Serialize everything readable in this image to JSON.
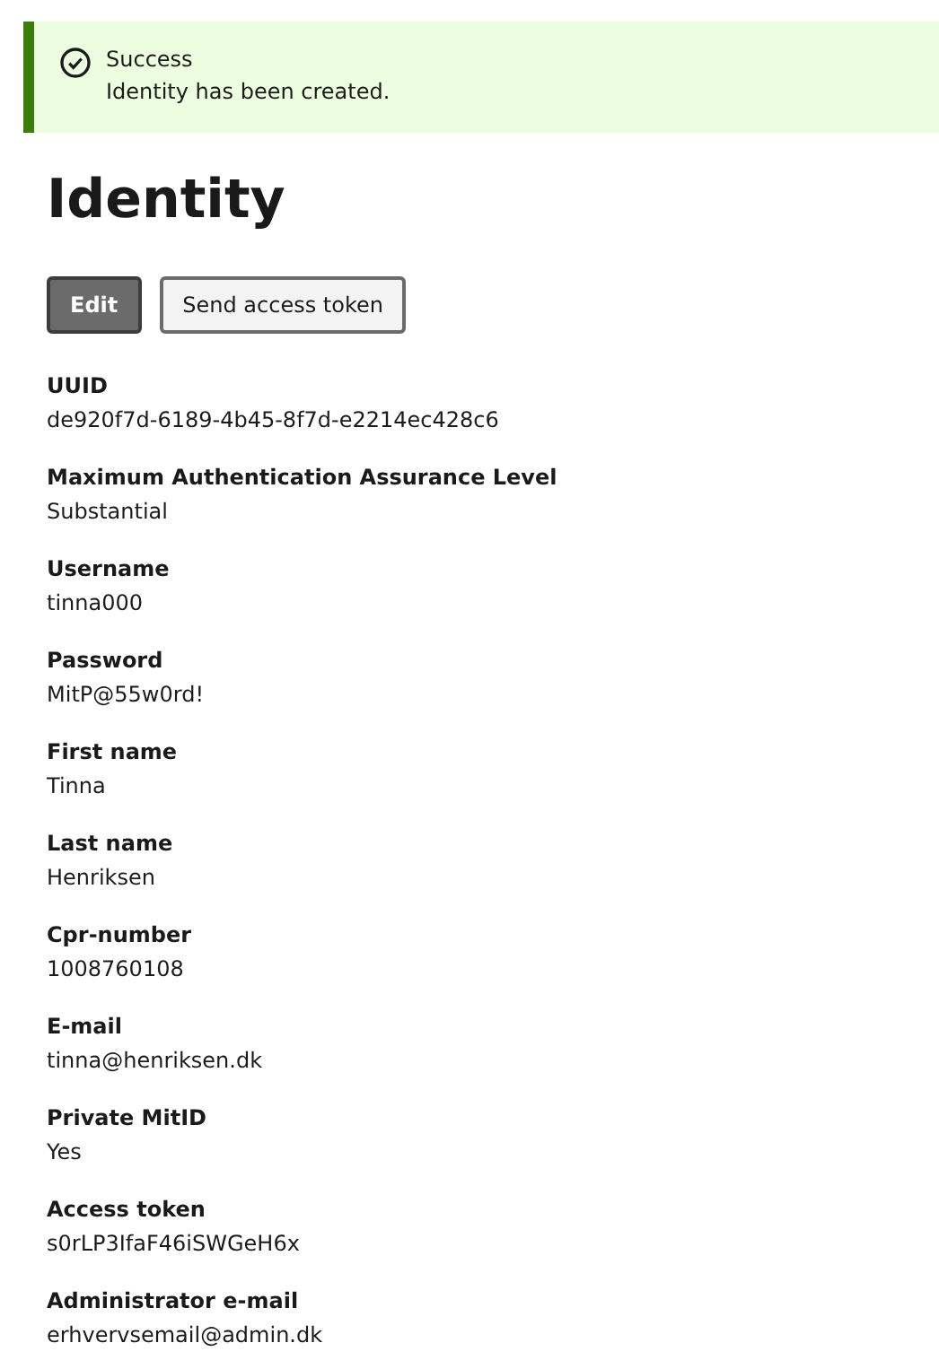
{
  "alert": {
    "title": "Success",
    "message": "Identity has been created."
  },
  "heading": "Identity",
  "buttons": [
    {
      "label": "Edit",
      "kind": "primary"
    },
    {
      "label": "Send access token",
      "kind": "secondary"
    }
  ],
  "fields": [
    {
      "label": "UUID",
      "value": "de920f7d-6189-4b45-8f7d-e2214ec428c6"
    },
    {
      "label": "Maximum Authentication Assurance Level",
      "value": "Substantial"
    },
    {
      "label": "Username",
      "value": "tinna000"
    },
    {
      "label": "Password",
      "value": "MitP@55w0rd!"
    },
    {
      "label": "First name",
      "value": "Tinna"
    },
    {
      "label": "Last name",
      "value": "Henriksen"
    },
    {
      "label": "Cpr-number",
      "value": "1008760108"
    },
    {
      "label": "E-mail",
      "value": "tinna@henriksen.dk"
    },
    {
      "label": "Private MitID",
      "value": "Yes"
    },
    {
      "label": "Access token",
      "value": "s0rLP3IfaF46iSWGeH6x"
    },
    {
      "label": "Administrator e-mail",
      "value": "erhvervsemail@admin.dk"
    }
  ]
}
